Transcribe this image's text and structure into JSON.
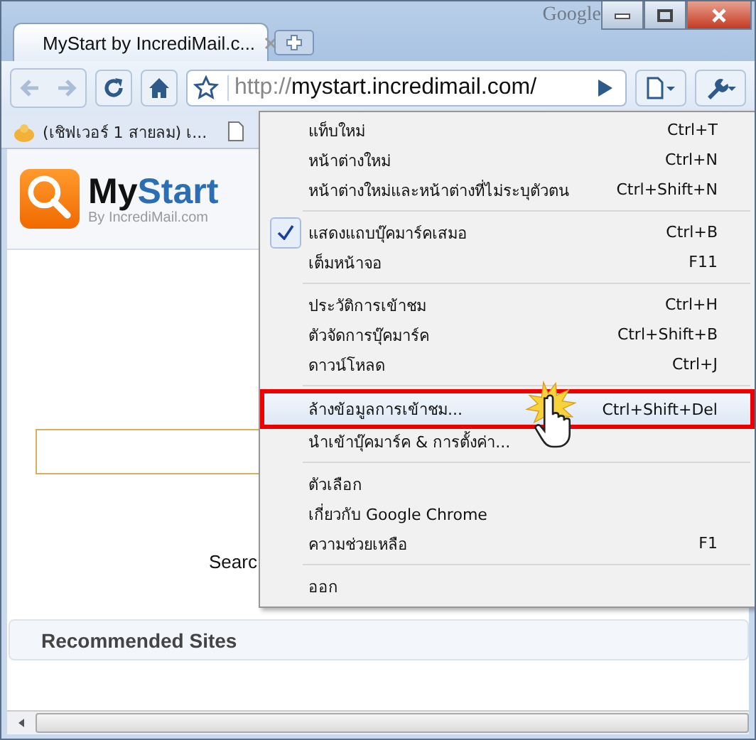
{
  "window": {
    "brand": "Google"
  },
  "tabs": [
    {
      "title": "MyStart by IncrediMail.c...",
      "selected": true
    }
  ],
  "address_bar": {
    "scheme": "http://",
    "host": "mystart.incredimail.com/"
  },
  "bookmarks": [
    {
      "label": "(เชิฟเวอร์ 1 สายลม) เ..."
    }
  ],
  "page": {
    "logo_title_a": "My",
    "logo_title_b": "Start",
    "logo_subtitle": "By IncrediMail.com",
    "search_label": "Searc",
    "recommended_title": "Recommended Sites"
  },
  "menu": {
    "groups": [
      [
        {
          "label": "แท็บใหม่",
          "shortcut": "Ctrl+T",
          "checked": false,
          "selected": false
        },
        {
          "label": "หน้าต่างใหม่",
          "shortcut": "Ctrl+N",
          "checked": false,
          "selected": false
        },
        {
          "label": "หน้าต่างใหม่และหน้าต่างที่ไม่ระบุตัวตน",
          "shortcut": "Ctrl+Shift+N",
          "checked": false,
          "selected": false
        }
      ],
      [
        {
          "label": "แสดงแถบบุ๊คมาร์คเสมอ",
          "shortcut": "Ctrl+B",
          "checked": true,
          "selected": false
        },
        {
          "label": "เต็มหน้าจอ",
          "shortcut": "F11",
          "checked": false,
          "selected": false
        }
      ],
      [
        {
          "label": "ประวัติการเข้าชม",
          "shortcut": "Ctrl+H",
          "checked": false,
          "selected": false
        },
        {
          "label": "ตัวจัดการบุ๊คมาร์ค",
          "shortcut": "Ctrl+Shift+B",
          "checked": false,
          "selected": false
        },
        {
          "label": "ดาวน์โหลด",
          "shortcut": "Ctrl+J",
          "checked": false,
          "selected": false
        }
      ],
      [
        {
          "label": "ล้างข้อมูลการเข้าชม...",
          "shortcut": "Ctrl+Shift+Del",
          "checked": false,
          "selected": true
        },
        {
          "label": "นำเข้าบุ๊คมาร์ค & การตั้งค่า...",
          "checked": false,
          "selected": false
        }
      ],
      [
        {
          "label": "ตัวเลือก",
          "checked": false,
          "selected": false
        },
        {
          "label": "เกี่ยวกับ Google Chrome",
          "checked": false,
          "selected": false
        },
        {
          "label": "ความช่วยเหลือ",
          "shortcut": "F1",
          "checked": false,
          "selected": false
        }
      ],
      [
        {
          "label": "ออก",
          "checked": false,
          "selected": false
        }
      ]
    ]
  }
}
